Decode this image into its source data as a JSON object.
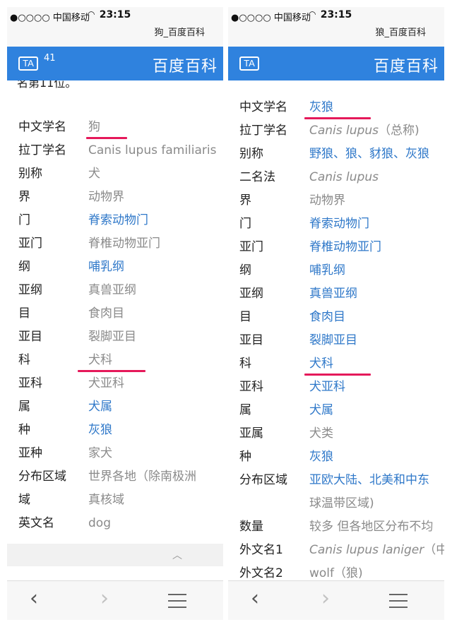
{
  "left": {
    "status": {
      "carrier": "●○○○○ 中国移动",
      "time": "23:15",
      "page_title": "狗_百度百科"
    },
    "appbar": {
      "icon": "TA",
      "badge": "41",
      "brand": "百度百科"
    },
    "cutoff_text": "名第11位。",
    "rows": [
      {
        "label": "中文学名",
        "value": "狗"
      },
      {
        "label": "拉丁学名",
        "value": "Canis lupus familiaris"
      },
      {
        "label": "别称",
        "value": "犬"
      },
      {
        "label": "界",
        "value": "动物界"
      },
      {
        "label": "门",
        "value": "脊索动物门"
      },
      {
        "label": "亚门",
        "value": "脊椎动物亚门"
      },
      {
        "label": "纲",
        "value": "哺乳纲"
      },
      {
        "label": "亚纲",
        "value": "真兽亚纲"
      },
      {
        "label": "目",
        "value": "食肉目"
      },
      {
        "label": "亚目",
        "value": "裂脚亚目"
      },
      {
        "label": "科",
        "value": "犬科"
      },
      {
        "label": "亚科",
        "value": "犬亚科"
      },
      {
        "label": "属",
        "value": "犬属"
      },
      {
        "label": "种",
        "value": "灰狼"
      },
      {
        "label": "亚种",
        "value": "家犬"
      },
      {
        "label": "分布区域",
        "value": "世界各地（除南极洲"
      },
      {
        "label": "域",
        "value": "真核域"
      },
      {
        "label": "英文名",
        "value": "dog"
      }
    ]
  },
  "right": {
    "status": {
      "carrier": "●○○○○ 中国移动",
      "time": "23:15",
      "page_title": "狼_百度百科"
    },
    "appbar": {
      "icon": "TA",
      "brand": "百度百科"
    },
    "rows": [
      {
        "label": "中文学名",
        "value": "灰狼"
      },
      {
        "label": "拉丁学名",
        "value": "Canis lupus",
        "value_suffix": "（总称)"
      },
      {
        "label": "别称",
        "value": "野狼、狼、豺狼、灰狼"
      },
      {
        "label": "二名法",
        "value": "Canis lupus"
      },
      {
        "label": "界",
        "value": "动物界"
      },
      {
        "label": "门",
        "value": "脊索动物门"
      },
      {
        "label": "亚门",
        "value": "脊椎动物亚门"
      },
      {
        "label": "纲",
        "value": "哺乳纲"
      },
      {
        "label": "亚纲",
        "value": "真兽亚纲"
      },
      {
        "label": "目",
        "value": "食肉目"
      },
      {
        "label": "亚目",
        "value": "裂脚亚目"
      },
      {
        "label": "科",
        "value": "犬科"
      },
      {
        "label": "亚科",
        "value": "犬亚科"
      },
      {
        "label": "属",
        "value": "犬属"
      },
      {
        "label": "亚属",
        "value": "犬类"
      },
      {
        "label": "种",
        "value": "灰狼"
      },
      {
        "label": "分布区域",
        "value": "亚欧大陆、北美和中东",
        "value_line2": "球温带区域)"
      },
      {
        "label": "数量",
        "value": "较多 但各地区分布不均"
      },
      {
        "label": "外文名1",
        "value": "Canis lupus laniger",
        "value_suffix": "（中"
      },
      {
        "label": "外文名2",
        "value": "wolf（狼)"
      }
    ]
  },
  "toolbar": {
    "back": "‹",
    "forward": "›"
  },
  "colors": {
    "appbar": "#2f82de",
    "link": "#2f78c9",
    "highlight": "#e5195a",
    "muted": "#8a8a8a"
  }
}
